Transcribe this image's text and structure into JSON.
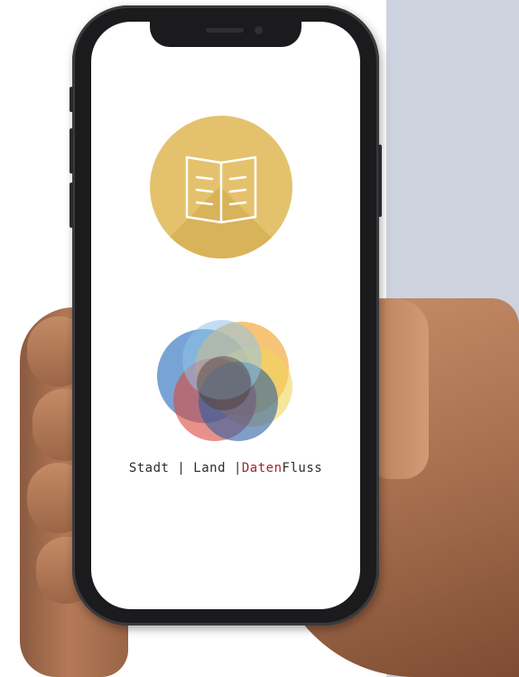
{
  "logo": {
    "word1": "Stadt",
    "word2": "Land",
    "word3_accent": "Daten",
    "word3_rest": "Fluss",
    "separator": "|"
  },
  "icons": {
    "book": "book-icon",
    "logo_mark": "overlapping-circles-logo"
  },
  "colors": {
    "book_circle": "#e4c26d",
    "accent_red": "#a0262a",
    "side_panel": "#cdd3de"
  }
}
